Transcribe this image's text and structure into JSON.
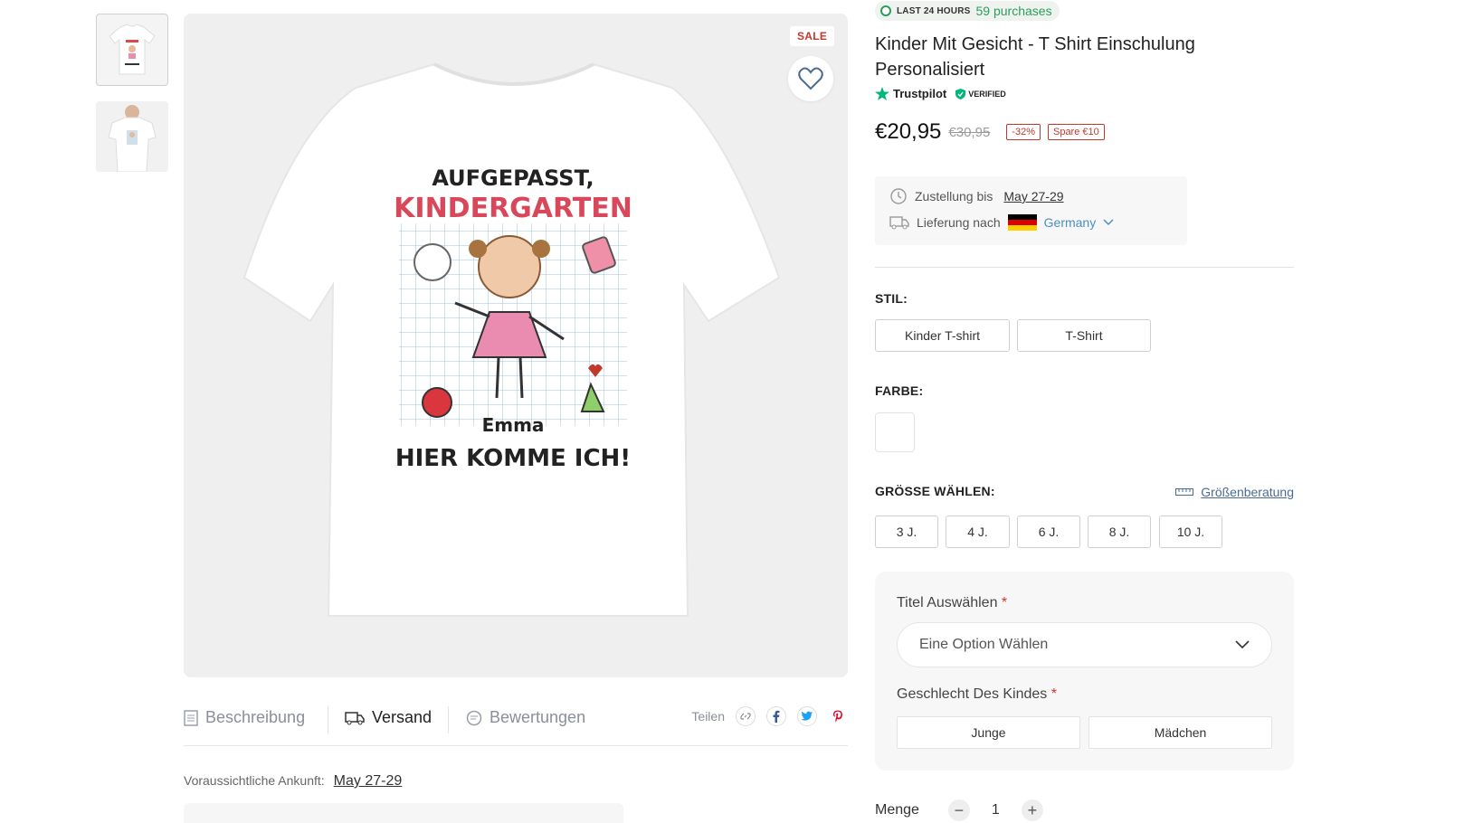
{
  "gallery": {
    "sale_badge": "SALE",
    "shirt_print": {
      "line1": "AUFGEPASST,",
      "line2": "KINDERGARTEN",
      "name": "Emma",
      "line3": "HIER KOMME ICH!"
    }
  },
  "tabs": [
    {
      "label": "Beschreibung",
      "icon": "document-icon",
      "active": false
    },
    {
      "label": "Versand",
      "icon": "truck-icon",
      "active": true
    },
    {
      "label": "Bewertungen",
      "icon": "chat-icon",
      "active": false
    }
  ],
  "share": {
    "label": "Teilen",
    "icons": [
      "link-icon",
      "facebook-icon",
      "twitter-icon",
      "pinterest-icon"
    ]
  },
  "arrival": {
    "label": "Voraussichtliche Ankunft:",
    "date": "May 27-29"
  },
  "product": {
    "purchases_label": "LAST 24 HOURS",
    "purchases_count": "59 purchases",
    "title": "Kinder Mit Gesicht - T Shirt Einschulung Personalisiert",
    "trustpilot": "Trustpilot",
    "verified": "VERIFIED",
    "price": "€20,95",
    "old_price": "€30,95",
    "discount": "-32%",
    "savings": "Spare €10"
  },
  "delivery": {
    "date_label": "Zustellung bis",
    "date": "May 27-29",
    "ship_label": "Lieferung nach",
    "country": "Germany"
  },
  "style": {
    "label": "STIL:",
    "options": [
      "Kinder T-shirt",
      "T-Shirt"
    ]
  },
  "color": {
    "label": "FARBE:",
    "swatch": "#ffffff"
  },
  "size": {
    "label": "GRÖSSE WÄHLEN:",
    "guide": "Größenberatung",
    "options": [
      "3 J.",
      "4 J.",
      "6 J.",
      "8 J.",
      "10 J."
    ]
  },
  "personalize": {
    "title_label": "Titel Auswählen",
    "required": "*",
    "title_placeholder": "Eine Option Wählen",
    "gender_label": "Geschlecht Des Kindes",
    "gender_options": [
      "Junge",
      "Mädchen"
    ]
  },
  "quantity": {
    "label": "Menge",
    "value": "1",
    "minus": "−",
    "plus": "+"
  },
  "colors": {
    "accent_green": "#2c9d5a",
    "sale_red": "#c0392b",
    "link_blue": "#4a90c2"
  }
}
